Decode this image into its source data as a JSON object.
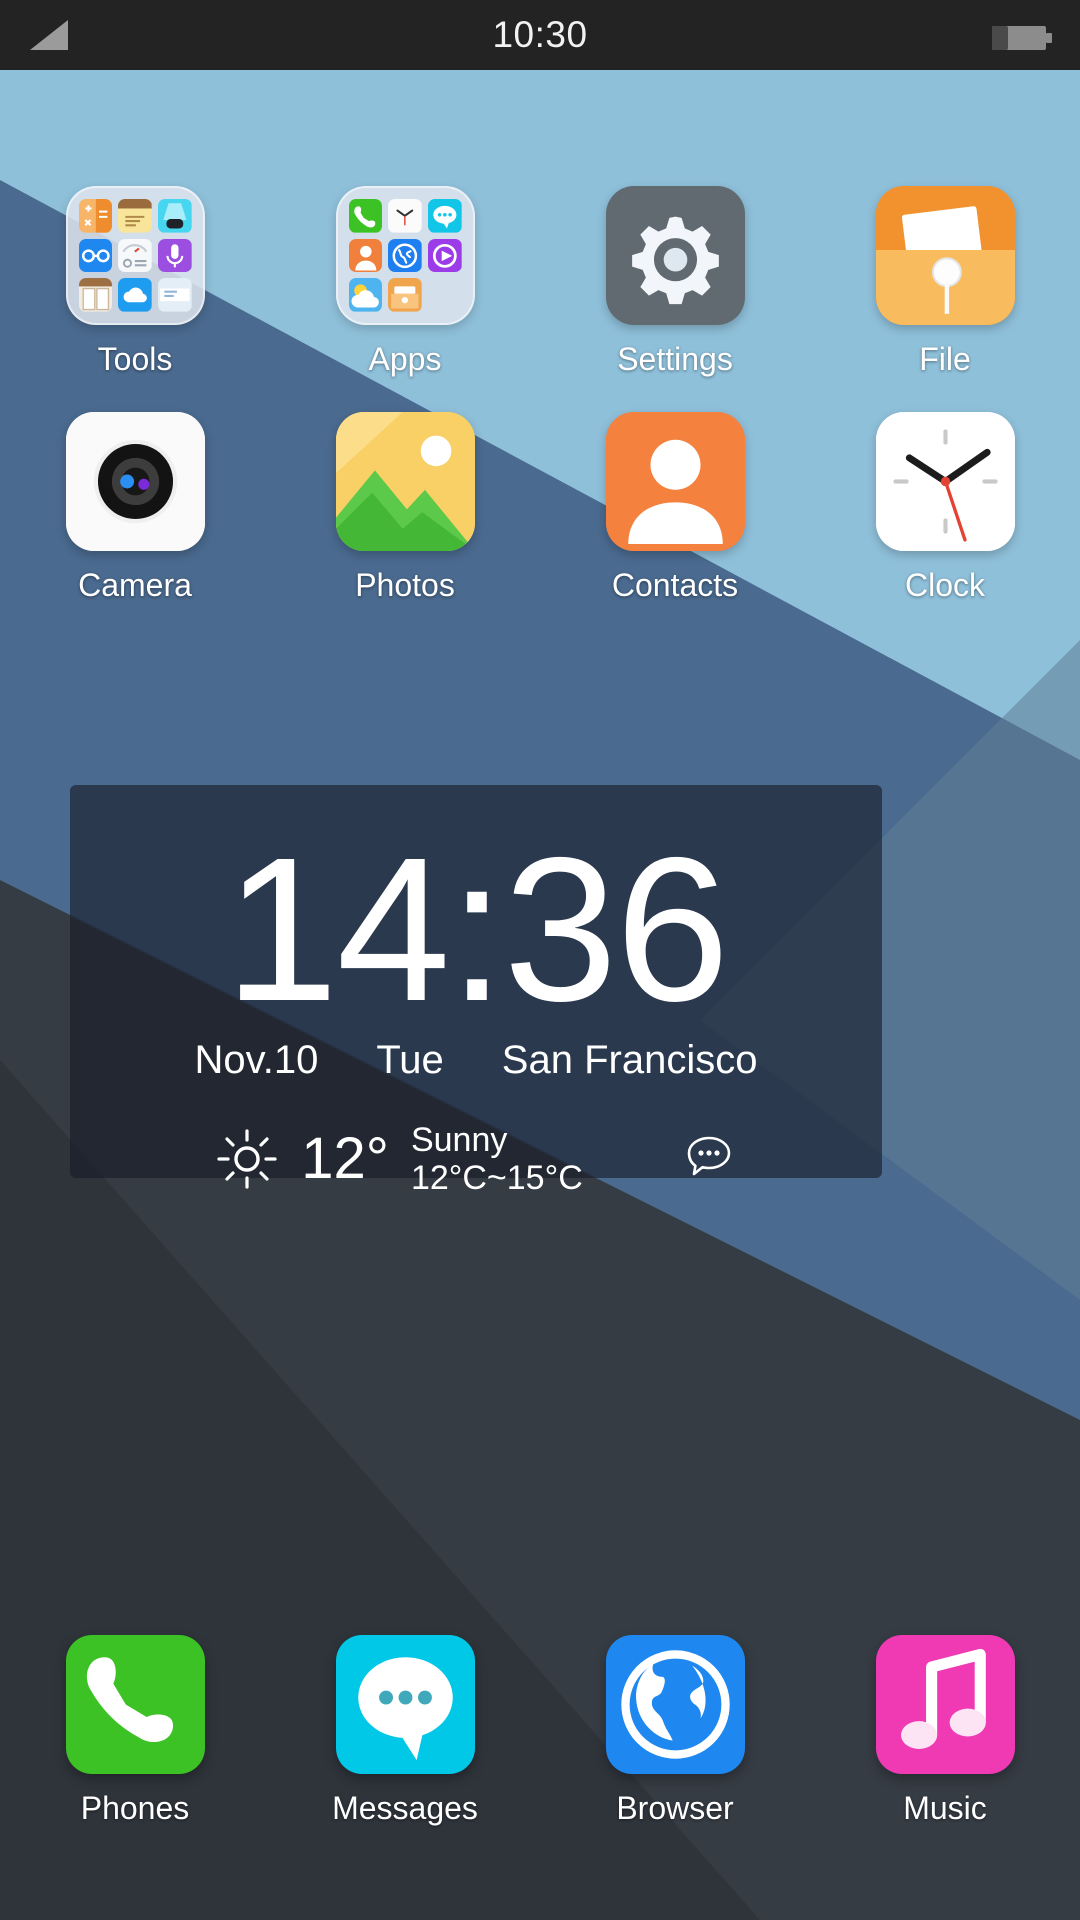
{
  "status_bar": {
    "time": "10:30",
    "signal_icon": "signal-bars-icon",
    "battery_icon": "battery-icon"
  },
  "theme": {
    "wallpaper_light_blue": "#8fc0da",
    "wallpaper_slate_blue": "#4a6a8f",
    "wallpaper_dark": "#363c44",
    "wallpaper_darkest": "#2b3036",
    "status_bar_bg": "#232323",
    "widget_bg": "rgba(22,28,38,0.62)",
    "label_color": "#ffffff"
  },
  "home_screen": {
    "row1": [
      {
        "label": "Tools",
        "type": "folder",
        "icon": "folder-tools-icon",
        "mini_icons": [
          {
            "name": "calculator-icon",
            "color": "#f5a23c"
          },
          {
            "name": "notes-icon",
            "color": "#f6dd8e"
          },
          {
            "name": "flashlight-icon",
            "color": "#3fd0ee"
          },
          {
            "name": "compass-icon",
            "color": "#1e88f0"
          },
          {
            "name": "remote-icon",
            "color": "#f4f6f8"
          },
          {
            "name": "recorder-icon",
            "color": "#9b4ee0"
          },
          {
            "name": "book-icon",
            "color": "#f0ece4"
          },
          {
            "name": "cloud-icon",
            "color": "#1e9cf0"
          },
          {
            "name": "news-icon",
            "color": "#dfe9f2"
          }
        ]
      },
      {
        "label": "Apps",
        "type": "folder",
        "icon": "folder-apps-icon",
        "mini_icons": [
          {
            "name": "phone-icon",
            "color": "#3cc224"
          },
          {
            "name": "clock-icon",
            "color": "#fbfbfb"
          },
          {
            "name": "messages-icon",
            "color": "#12c6e8"
          },
          {
            "name": "contacts-icon",
            "color": "#f0803c"
          },
          {
            "name": "browser-icon",
            "color": "#1e7ff0"
          },
          {
            "name": "video-icon",
            "color": "#9b3ce8"
          },
          {
            "name": "weather-icon",
            "color": "#4eb4f0"
          },
          {
            "name": "file-icon",
            "color": "#f0a44c"
          },
          {
            "name": "empty-slot",
            "color": "transparent"
          }
        ]
      },
      {
        "label": "Settings",
        "type": "app",
        "icon": "settings-gear-icon",
        "color": "#616a70"
      },
      {
        "label": "File",
        "type": "app",
        "icon": "file-folder-icon",
        "color": "#f5a93c"
      }
    ],
    "row2": [
      {
        "label": "Camera",
        "type": "app",
        "icon": "camera-icon",
        "color": "#fafafa"
      },
      {
        "label": "Photos",
        "type": "app",
        "icon": "photos-icon",
        "color": "#f7cf5a"
      },
      {
        "label": "Contacts",
        "type": "app",
        "icon": "contacts-icon",
        "color": "#f4813e"
      },
      {
        "label": "Clock",
        "type": "app",
        "icon": "clock-icon",
        "color": "#ffffff"
      }
    ]
  },
  "clock_widget": {
    "time": "14:36",
    "date": "Nov.10",
    "weekday": "Tue",
    "city": "San Francisco",
    "weather_icon": "sun-icon",
    "temperature": "12°",
    "condition": "Sunny",
    "temp_range": "12°C~15°C",
    "bubble_icon": "speech-bubble-icon"
  },
  "dock": [
    {
      "label": "Phones",
      "icon": "phone-handset-icon",
      "color": "#3cc224"
    },
    {
      "label": "Messages",
      "icon": "message-bubble-icon",
      "color": "#00c8e6"
    },
    {
      "label": "Browser",
      "icon": "globe-icon",
      "color": "#1e88f0"
    },
    {
      "label": "Music",
      "icon": "music-note-icon",
      "color": "#f03ab4"
    }
  ]
}
